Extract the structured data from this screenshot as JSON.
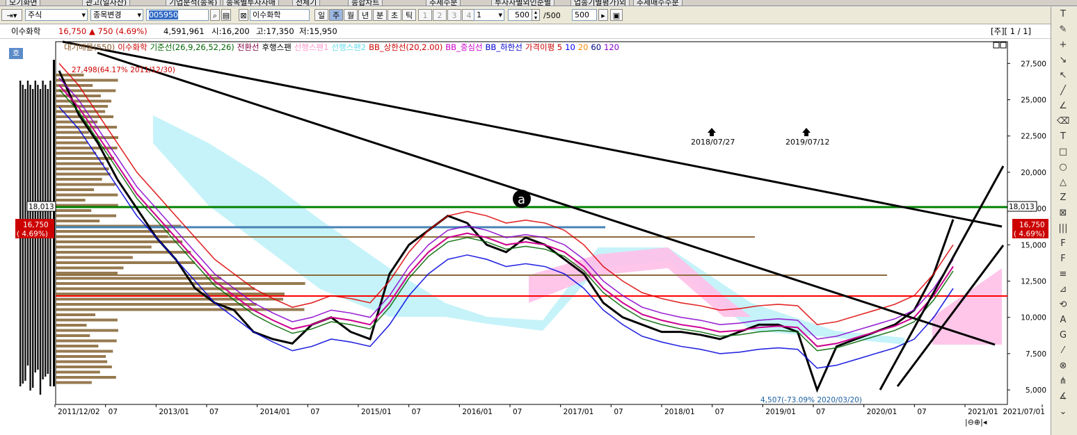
{
  "tabs": [
    "모기화면",
    "관고(일자산)",
    "기업분석(종목)",
    "종목별투자자매",
    "전체기",
    "종합차트",
    "추세수분",
    "투자자별외인순별",
    "업종기별평가)외",
    "추세매수수분"
  ],
  "toolbar": {
    "market_select": "주식",
    "change_button": "종목변경",
    "code_input": "005950",
    "name_field": "이수화학",
    "period_buttons": [
      "일",
      "주",
      "월",
      "년",
      "분",
      "초",
      "틱"
    ],
    "active_period": "주",
    "num_buttons": [
      "1",
      "2",
      "3",
      "4"
    ],
    "interval_value": "1",
    "count_value": "500",
    "count_max": "/500",
    "count_value2": "500"
  },
  "info": {
    "name": "이수화학",
    "price": "16,750",
    "change": "▲ 750 (4.69%)",
    "volume": "4,591,961",
    "open": "시:16,200",
    "high": "고:17,350",
    "low": "저:15,950",
    "page": "[주][ 1 / 1]"
  },
  "side_label": "호",
  "legend": [
    {
      "text": "대기매물(550)",
      "color": "#8b5a2b"
    },
    {
      "text": "이수화학",
      "color": "#cc0000"
    },
    {
      "text": "기준선(26,9,26,52,26)",
      "color": "#006600"
    },
    {
      "text": "전환선",
      "color": "#800040"
    },
    {
      "text": "후행스팬",
      "color": "#000000"
    },
    {
      "text": "선행스팬1",
      "color": "#ff99cc"
    },
    {
      "text": "선행스팬2",
      "color": "#66ddee"
    },
    {
      "text": "BB_상한선(20,2.00)",
      "color": "#cc0000"
    },
    {
      "text": "BB_중심선",
      "color": "#cc00cc"
    },
    {
      "text": "BB_하한선",
      "color": "#0000cc"
    },
    {
      "text": "가격이평 5",
      "color": "#cc0000"
    },
    {
      "text": "10",
      "color": "#0000ff"
    },
    {
      "text": "20",
      "color": "#ff8800"
    },
    {
      "text": "60",
      "color": "#000080"
    },
    {
      "text": "120",
      "color": "#8800cc"
    }
  ],
  "annotations": {
    "high_label": "27,498(64.17% 2011/12/30)",
    "low_label": "4,507(-73.09% 2020/03/20)",
    "marker_a": "a",
    "date_mark_1": "2018/07/27",
    "date_mark_2": "2019/07/12",
    "left_price_tag": "18,013",
    "right_price_tag": "18,013",
    "current_tag_left_1": "16,750",
    "current_tag_left_2": "( 4.69%)",
    "current_tag_right_1": "16,750",
    "current_tag_right_2": "( 4.69%)"
  },
  "chart_data": {
    "type": "line",
    "title": "",
    "xlabel": "",
    "ylabel": "",
    "ylim": [
      4000,
      29000
    ],
    "y_ticks": [
      "27,500",
      "25,000",
      "22,500",
      "20,000",
      "17,500",
      "15,000",
      "12,500",
      "10,000",
      "7,500",
      "5,000"
    ],
    "x_ticks": [
      "2011/12/02",
      "07",
      "2013/01",
      "07",
      "2014/01",
      "07",
      "2015/01",
      "07",
      "2016/01",
      "07",
      "2017/01",
      "07",
      "2018/01",
      "07",
      "2019/01",
      "07",
      "2020/01",
      "07",
      "2021/01",
      "2021/07/01"
    ],
    "x_range": [
      "2011/12/02",
      "2021/07/01"
    ],
    "series": [
      {
        "values": [
          27000,
          24000,
          22000,
          19500,
          17500,
          15500,
          14000,
          12000,
          11000,
          10500,
          9000,
          8500,
          8200,
          9500,
          10000,
          9000,
          8500,
          13000,
          15000,
          16000,
          17000,
          16500,
          15000,
          14500,
          15500,
          15000,
          14000,
          13000,
          11000,
          10000,
          9500,
          9000,
          9000,
          8800,
          8500,
          9000,
          9500,
          9500,
          9000,
          5000,
          8000,
          8500,
          9000,
          9500,
          10500,
          13000,
          16750
        ]
      },
      {
        "values": [
          26000,
          24500,
          22500,
          20500,
          18500,
          17000,
          15500,
          14000,
          12500,
          11500,
          10500,
          9800,
          9200,
          9500,
          10000,
          9800,
          9500,
          11000,
          13000,
          14500,
          15500,
          15800,
          15500,
          15000,
          15200,
          15000,
          14500,
          13500,
          12000,
          11000,
          10200,
          9800,
          9500,
          9300,
          9000,
          9100,
          9300,
          9400,
          9300,
          8000,
          8200,
          8600,
          9000,
          9400,
          10000,
          11500,
          13500
        ]
      }
    ],
    "grid": false,
    "legend_position": "top-left"
  },
  "colors": {
    "price_up": "#cc0000",
    "accent_green": "#008000",
    "accent_blue": "#4682b4",
    "red_line": "#ff0000",
    "bb_upper": "#dd0000",
    "bb_lower": "#0000dd",
    "cloud_pink": "#ffc0e8",
    "cloud_cyan": "#b8f0f8",
    "volume_profile": "#8b6b3d"
  }
}
